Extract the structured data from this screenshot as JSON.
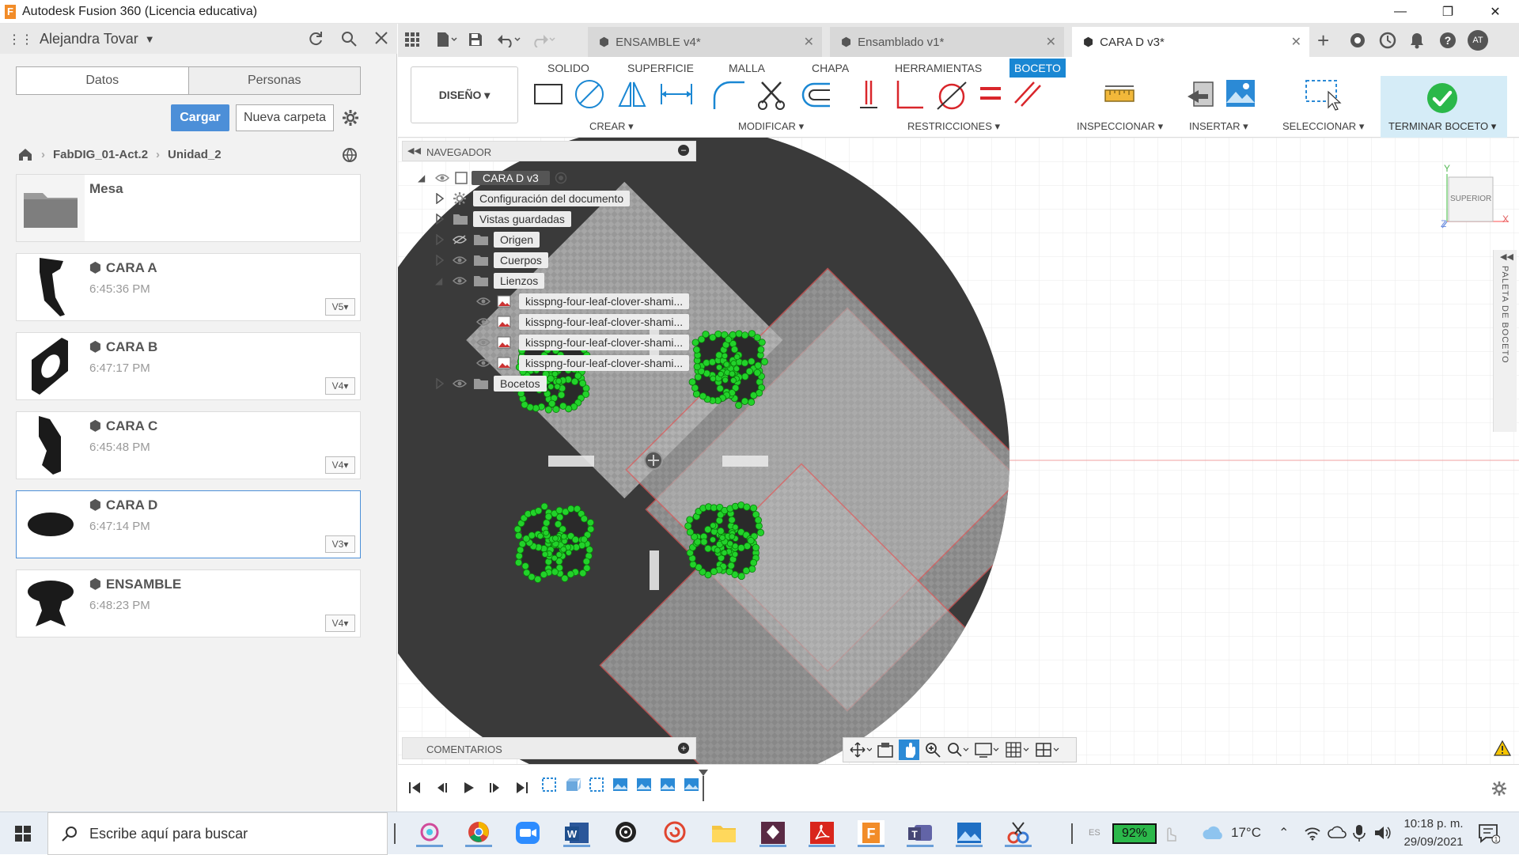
{
  "window": {
    "title": "Autodesk Fusion 360 (Licencia educativa)",
    "logo": "F"
  },
  "left_panel": {
    "user": "Alejandra Tovar",
    "tabs": [
      "Datos",
      "Personas"
    ],
    "upload_button": "Cargar",
    "new_folder_button": "Nueva carpeta",
    "breadcrumb": [
      "FabDIG_01-Act.2",
      "Unidad_2"
    ],
    "folder": {
      "name": "Mesa"
    },
    "files": [
      {
        "name": "CARA A",
        "time": "6:45:36 PM",
        "version": "V5"
      },
      {
        "name": "CARA B",
        "time": "6:47:17 PM",
        "version": "V4"
      },
      {
        "name": "CARA C",
        "time": "6:45:48 PM",
        "version": "V4"
      },
      {
        "name": "CARA D",
        "time": "6:47:14 PM",
        "version": "V3"
      },
      {
        "name": "ENSAMBLE",
        "time": "6:48:23 PM",
        "version": "V4"
      }
    ]
  },
  "doc_tabs": [
    {
      "label": "ENSAMBLE v4*"
    },
    {
      "label": "Ensamblado v1*"
    },
    {
      "label": "CARA D v3*"
    }
  ],
  "header_right": {
    "avatar": "AT"
  },
  "ribbon": {
    "tabs": [
      "SOLIDO",
      "SUPERFICIE",
      "MALLA",
      "CHAPA",
      "HERRAMIENTAS",
      "BOCETO"
    ],
    "workspace": "DISEÑO",
    "groups": [
      "CREAR",
      "MODIFICAR",
      "RESTRICCIONES",
      "INSPECCIONAR",
      "INSERTAR",
      "SELECCIONAR",
      "TERMINAR BOCETO"
    ]
  },
  "navigator": {
    "title": "NAVEGADOR",
    "root": "CARA D v3",
    "items": [
      "Configuración del documento",
      "Vistas guardadas",
      "Origen",
      "Cuerpos",
      "Lienzos"
    ],
    "canvases": [
      "kisspng-four-leaf-clover-shami...",
      "kisspng-four-leaf-clover-shami...",
      "kisspng-four-leaf-clover-shami...",
      "kisspng-four-leaf-clover-shami..."
    ],
    "sketches": "Bocetos"
  },
  "viewcube": {
    "label": "SUPERIOR",
    "x": "X",
    "y": "Y",
    "z": "Z"
  },
  "sketch_palette": "PALETA DE BOCETO",
  "comments": {
    "title": "COMENTARIOS"
  },
  "taskbar": {
    "search_placeholder": "Escribe aquí para buscar",
    "zoom": "92%",
    "temperature": "17°C",
    "time": "10:18 p. m.",
    "date": "29/09/2021",
    "lang": "ES"
  },
  "colors": {
    "accent": "#1a87d3",
    "sketch_green": "#22d22a",
    "body": "#3a3a3a",
    "finish_green": "#2bb84a"
  }
}
